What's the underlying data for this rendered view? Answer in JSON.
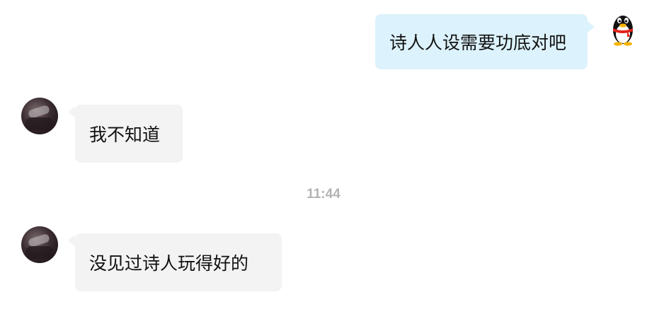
{
  "messages": [
    {
      "id": "m1",
      "direction": "outgoing",
      "text": "诗人人设需要功底对吧",
      "avatar": "qq-penguin-icon"
    },
    {
      "id": "m2",
      "direction": "incoming",
      "text": "我不知道",
      "avatar": "contact-avatar"
    },
    {
      "id": "m3",
      "direction": "incoming",
      "text": "没见过诗人玩得好的",
      "avatar": "contact-avatar"
    }
  ],
  "timestamp": "11:44",
  "colors": {
    "outgoing_bubble": "#dcf2fc",
    "incoming_bubble": "#f3f3f3",
    "timestamp_text": "#b3b3b3",
    "background": "#ffffff"
  }
}
